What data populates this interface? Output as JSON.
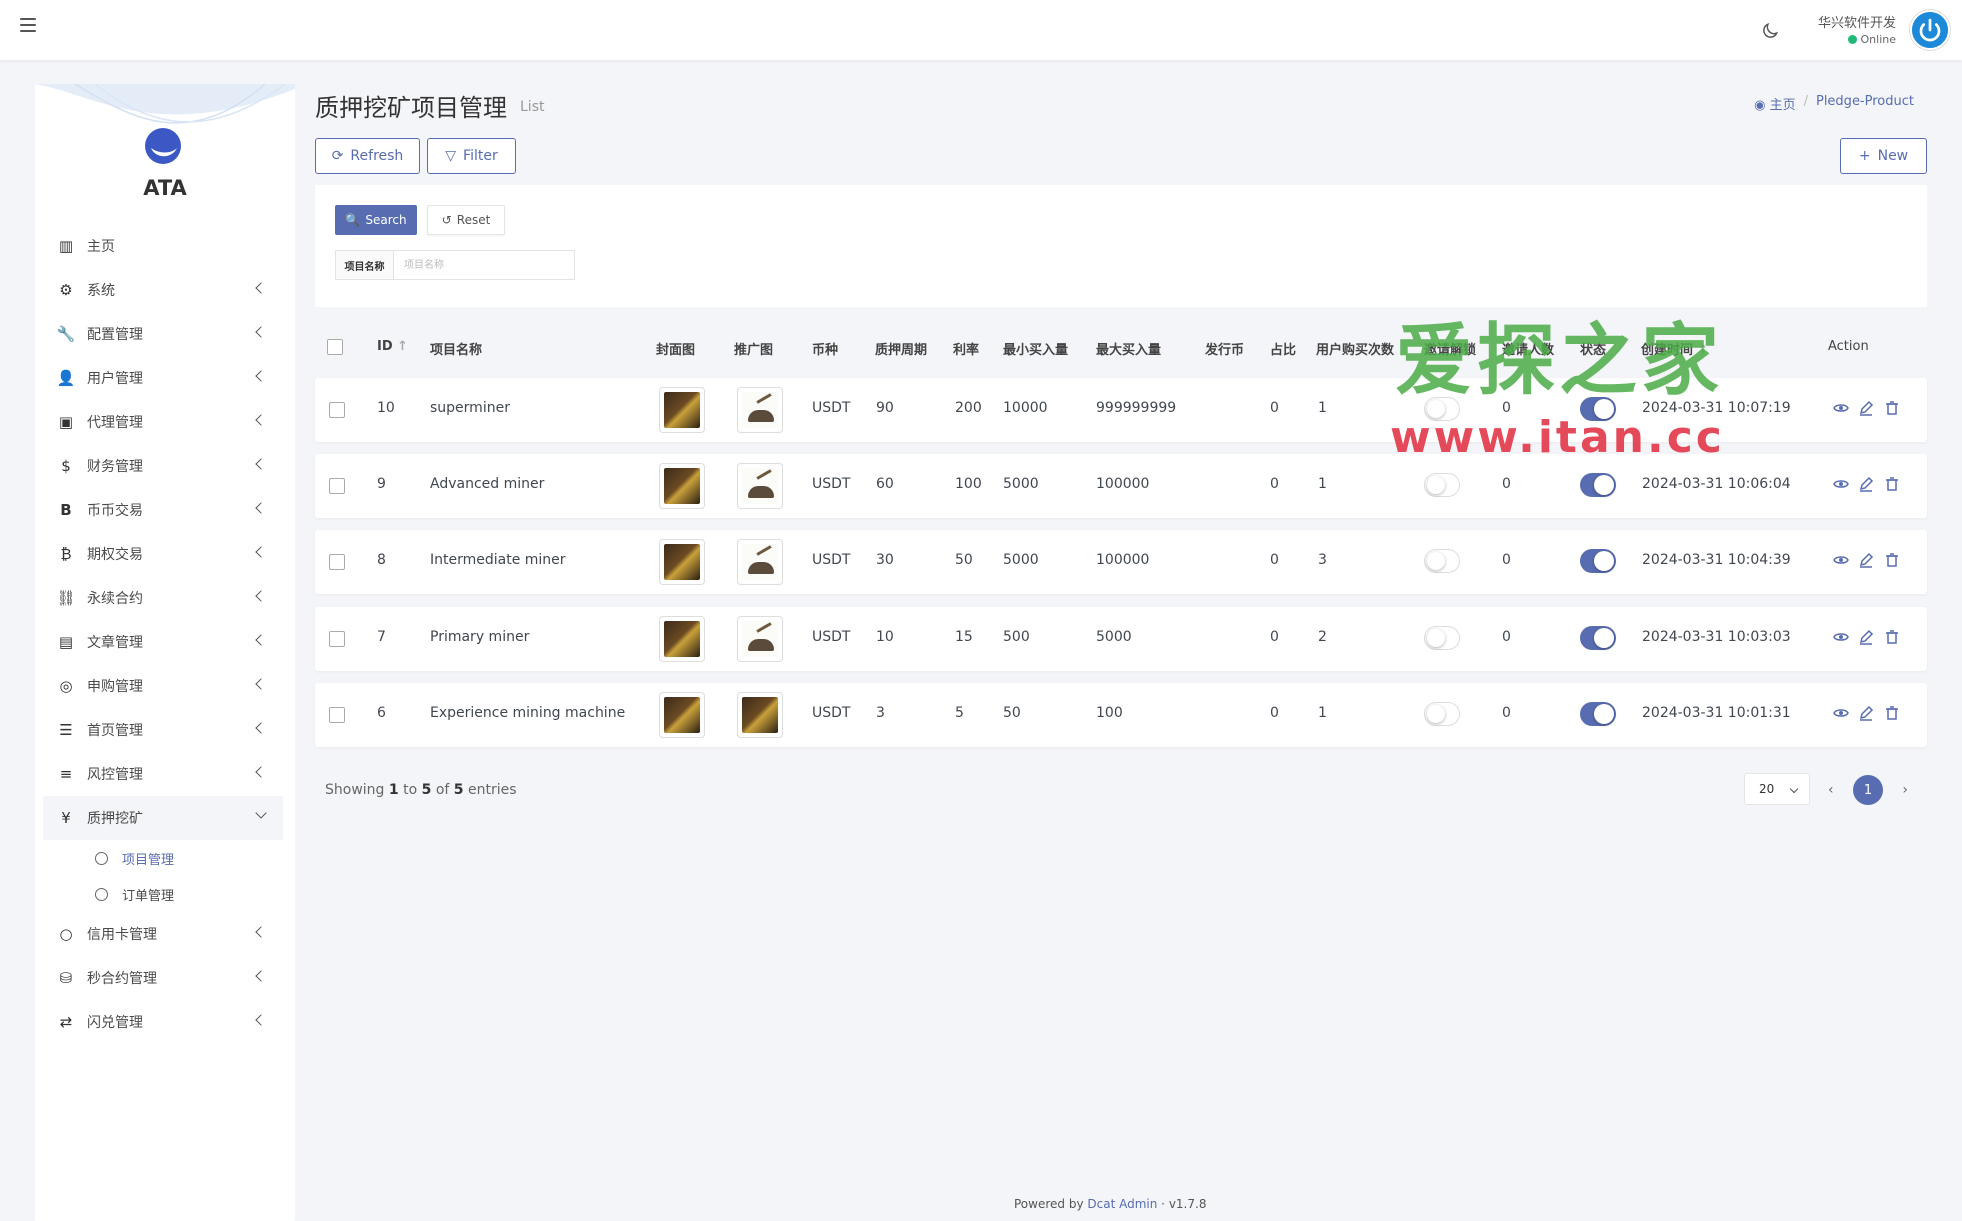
{
  "header": {
    "user_name": "华兴软件开发",
    "user_status": "Online"
  },
  "sidebar": {
    "logo_text": "ATA",
    "items": [
      {
        "label": "主页",
        "icon": "bar-chart-icon"
      },
      {
        "label": "系统",
        "icon": "gear-icon"
      },
      {
        "label": "配置管理",
        "icon": "wrench-icon"
      },
      {
        "label": "用户管理",
        "icon": "users-icon"
      },
      {
        "label": "代理管理",
        "icon": "id-card-icon"
      },
      {
        "label": "财务管理",
        "icon": "dollar-icon"
      },
      {
        "label": "币币交易",
        "icon": "bitcoin-b-icon"
      },
      {
        "label": "期权交易",
        "icon": "bitcoin-icon"
      },
      {
        "label": "永续合约",
        "icon": "link-icon"
      },
      {
        "label": "文章管理",
        "icon": "newspaper-icon"
      },
      {
        "label": "申购管理",
        "icon": "lifebuoy-icon"
      },
      {
        "label": "首页管理",
        "icon": "list-icon"
      },
      {
        "label": "风控管理",
        "icon": "indent-icon"
      },
      {
        "label": "质押挖矿",
        "icon": "yen-icon"
      },
      {
        "label": "信用卡管理",
        "icon": "circle-icon"
      },
      {
        "label": "秒合约管理",
        "icon": "coins-icon"
      },
      {
        "label": "闪兑管理",
        "icon": "exchange-icon"
      }
    ],
    "sub_items": [
      {
        "label": "项目管理"
      },
      {
        "label": "订单管理"
      }
    ]
  },
  "page": {
    "title": "质押挖矿项目管理",
    "subtitle": "List",
    "breadcrumb": [
      "主页",
      "Pledge-Product"
    ]
  },
  "toolbar": {
    "refresh_label": "Refresh",
    "filter_label": "Filter",
    "new_label": "New"
  },
  "filter": {
    "search_label": "Search",
    "reset_label": "Reset",
    "field_label": "项目名称",
    "field_placeholder": "项目名称",
    "field_value": ""
  },
  "table": {
    "headers": {
      "id": "ID",
      "name": "项目名称",
      "cover": "封面图",
      "promo": "推广图",
      "coin": "币种",
      "period": "质押周期",
      "rate": "利率",
      "min_buy": "最小买入量",
      "max_buy": "最大买入量",
      "issue_coin": "发行币",
      "ratio": "占比",
      "user_buy_times": "用户购买次数",
      "invite_unlock": "邀请解锁",
      "invite_count": "邀请人数",
      "status": "状态",
      "created_at": "创建时间",
      "action": "Action"
    },
    "rows": [
      {
        "id": "10",
        "name": "superminer",
        "cover": "dark",
        "promo": "light",
        "coin": "USDT",
        "period": "90",
        "rate": "200",
        "min_buy": "10000",
        "max_buy": "999999999",
        "issue_coin": "",
        "ratio": "0",
        "user_buy_times": "1",
        "invite_unlock": false,
        "invite_count": "0",
        "status": true,
        "created_at": "2024-03-31 10:07:19"
      },
      {
        "id": "9",
        "name": "Advanced miner",
        "cover": "dark",
        "promo": "light",
        "coin": "USDT",
        "period": "60",
        "rate": "100",
        "min_buy": "5000",
        "max_buy": "100000",
        "issue_coin": "",
        "ratio": "0",
        "user_buy_times": "1",
        "invite_unlock": false,
        "invite_count": "0",
        "status": true,
        "created_at": "2024-03-31 10:06:04"
      },
      {
        "id": "8",
        "name": "Intermediate miner",
        "cover": "dark",
        "promo": "light",
        "coin": "USDT",
        "period": "30",
        "rate": "50",
        "min_buy": "5000",
        "max_buy": "100000",
        "issue_coin": "",
        "ratio": "0",
        "user_buy_times": "3",
        "invite_unlock": false,
        "invite_count": "0",
        "status": true,
        "created_at": "2024-03-31 10:04:39"
      },
      {
        "id": "7",
        "name": "Primary miner",
        "cover": "dark",
        "promo": "light",
        "coin": "USDT",
        "period": "10",
        "rate": "15",
        "min_buy": "500",
        "max_buy": "5000",
        "issue_coin": "",
        "ratio": "0",
        "user_buy_times": "2",
        "invite_unlock": false,
        "invite_count": "0",
        "status": true,
        "created_at": "2024-03-31 10:03:03"
      },
      {
        "id": "6",
        "name": "Experience mining machine",
        "cover": "dark",
        "promo": "dark",
        "coin": "USDT",
        "period": "3",
        "rate": "5",
        "min_buy": "50",
        "max_buy": "100",
        "issue_coin": "",
        "ratio": "0",
        "user_buy_times": "1",
        "invite_unlock": false,
        "invite_count": "0",
        "status": true,
        "created_at": "2024-03-31 10:01:31"
      }
    ]
  },
  "pagination": {
    "showing_prefix": "Showing",
    "from": "1",
    "to_word": "to",
    "to": "5",
    "of_word": "of",
    "total": "5",
    "entries_word": "entries",
    "per_page": "20",
    "current_page": "1"
  },
  "footer": {
    "powered_prefix": "Powered by",
    "powered_link": "Dcat Admin",
    "version": "v1.7.8"
  },
  "watermark": {
    "line1": "爱探之家",
    "line2": "www.itan.cc"
  },
  "colors": {
    "primary": "#586cb1",
    "online": "#21b978",
    "background": "#f4f5f9"
  }
}
